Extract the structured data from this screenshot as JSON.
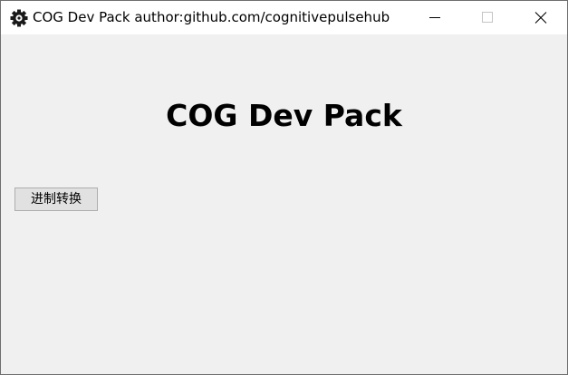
{
  "window": {
    "title": "COG Dev Pack author:github.com/cognitivepulsehub",
    "icon": "gear-icon",
    "controls": [
      "minimize-icon",
      "maximize-icon",
      "close-icon"
    ]
  },
  "main": {
    "heading": "COG Dev Pack",
    "buttons": [
      {
        "label": "进制转换"
      }
    ]
  },
  "colors": {
    "titlebar_bg": "#ffffff",
    "client_bg": "#f0f0f0",
    "button_bg": "#e1e1e1",
    "button_border": "#adadad",
    "text": "#000000"
  }
}
